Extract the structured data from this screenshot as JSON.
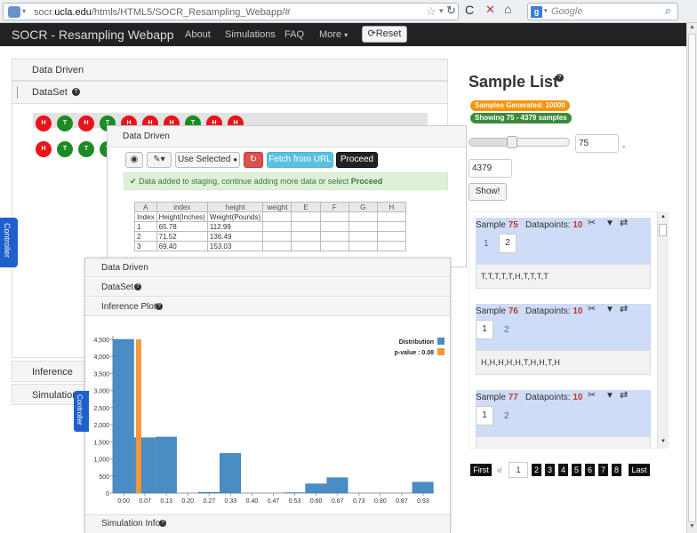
{
  "browser": {
    "url_prefix": "socr.",
    "url_domain": "ucla.edu",
    "url_suffix": "/htmls/HTML5/SOCR_Resampling_Webapp/#",
    "search_engine": "Google",
    "search_placeholder": "Google"
  },
  "nav": {
    "brand": "SOCR - Resampling Webapp",
    "links": [
      "About",
      "Simulations",
      "FAQ",
      "More"
    ],
    "reset": "Reset"
  },
  "left": {
    "data_driven": "Data Driven",
    "dataset": "DataSet",
    "inference": "Inference",
    "simulation": "Simulation",
    "controller": "Controller"
  },
  "coins": {
    "row1": [
      "H",
      "T",
      "H",
      "T",
      "H",
      "H",
      "H",
      "T",
      "H",
      "H"
    ],
    "row2": [
      "H",
      "T",
      "T",
      "T",
      "",
      "",
      "",
      "",
      "",
      ""
    ]
  },
  "colors": {
    "head": "#e8141a",
    "tail": "#1c8c22",
    "histogram": "#4a8cc4",
    "pvalue": "#f7953a",
    "nav": "#222222",
    "badge_orange": "#f89406",
    "badge_green": "#3a8a3a",
    "card": "#cfdcf7"
  },
  "mid": {
    "title": "Data Driven",
    "tools": [
      "",
      "",
      "Use Selected",
      "",
      "Fetch from URL",
      "Proceed"
    ],
    "alert_prefix": "Data added to staging, continue adding more data or select ",
    "alert_bold": "Proceed",
    "sheet": {
      "cols": [
        "A",
        "index",
        "height",
        "weight",
        "E",
        "F",
        "G",
        "H"
      ],
      "rows": [
        [
          "Index",
          "Height(Inches)",
          "Weight(Pounds)",
          "",
          "",
          "",
          "",
          ""
        ],
        [
          "1",
          "65.78",
          "112.99",
          "",
          "",
          "",
          "",
          ""
        ],
        [
          "2",
          "71.52",
          "136.49",
          "",
          "",
          "",
          "",
          ""
        ],
        [
          "3",
          "69.40",
          "153.03",
          "",
          "",
          "",
          "",
          ""
        ]
      ]
    }
  },
  "front": {
    "data_driven": "Data Driven",
    "dataset": "DataSet",
    "inference_plot": "Inference Plot",
    "simulation_info": "Simulation Info",
    "controller": "Controller"
  },
  "chart_data": {
    "type": "bar",
    "categories": [
      "0.00",
      "0.07",
      "0.13",
      "0.20",
      "0.27",
      "0.33",
      "0.40",
      "0.47",
      "0.53",
      "0.60",
      "0.67",
      "0.73",
      "0.80",
      "0.87",
      "0.93"
    ],
    "x_edges": [
      0.0,
      0.0667,
      0.1333,
      0.2,
      0.2667,
      0.3333,
      0.4,
      0.4667,
      0.5333,
      0.6,
      0.6667,
      0.7333,
      0.8,
      0.8667,
      0.9333,
      1.0
    ],
    "series": [
      {
        "name": "Distribution",
        "values": [
          4500,
          1620,
          1640,
          0,
          20,
          1160,
          0,
          0,
          10,
          270,
          450,
          0,
          0,
          0,
          320
        ]
      }
    ],
    "p_value_label": "p-value : 0.08",
    "p_value": 0.08,
    "yticks": [
      "0",
      "500",
      "1,000",
      "1,500",
      "2,000",
      "2,500",
      "3,000",
      "3,500",
      "4,000",
      "4,500"
    ],
    "ylim": [
      0,
      4500
    ],
    "legend_placement": "top-right"
  },
  "right": {
    "title": "Sample List",
    "badge_generated": "Samples Generated: 10000",
    "badge_showing": "Showing 75 - 4379 samples",
    "range_from": "75",
    "range_dash": "-",
    "range_to": "4379",
    "show_btn": "Show!",
    "samples": [
      {
        "label": "Sample",
        "num": "75",
        "dp_label": "Datapoints:",
        "dp": "10",
        "tabs": [
          "1",
          "2"
        ],
        "data": "T,T,T,T,T,H,T,T,T,T"
      },
      {
        "label": "Sample",
        "num": "76",
        "dp_label": "Datapoints:",
        "dp": "10",
        "tabs": [
          "1",
          "2"
        ],
        "data": "H,H,H,H,H,T,H,H,T,H"
      },
      {
        "label": "Sample",
        "num": "77",
        "dp_label": "Datapoints:",
        "dp": "10",
        "tabs": [
          "1",
          "2"
        ],
        "data": ""
      }
    ],
    "pager": {
      "first": "First",
      "prev": "«",
      "pages": [
        "1",
        "2",
        "3",
        "4",
        "5",
        "6",
        "7",
        "8"
      ],
      "last": "Last"
    }
  }
}
